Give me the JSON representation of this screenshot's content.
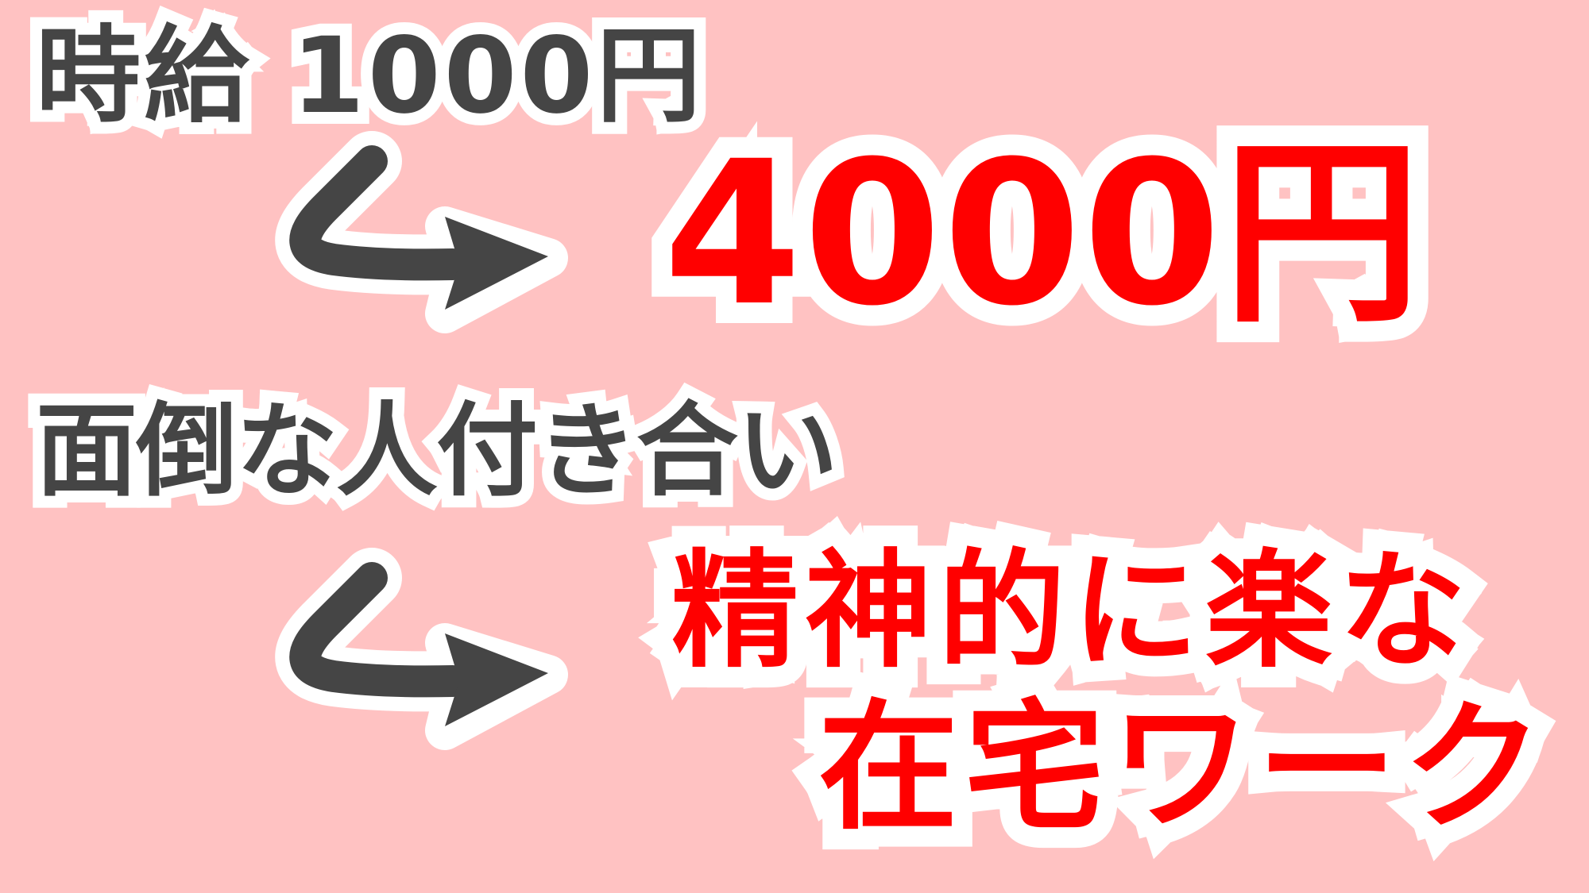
{
  "colors": {
    "background": "#ffc2c2",
    "dark_text": "#454545",
    "accent_red": "#ff0000",
    "outline": "#ffffff"
  },
  "top": {
    "before_text": "時給 1000円",
    "after_text": "4000円",
    "arrow_icon": "curved-arrow-right-icon"
  },
  "bottom": {
    "before_text": "面倒な人付き合い",
    "after_line1": "精神的に楽な",
    "after_line2": "在宅ワーク",
    "arrow_icon": "curved-arrow-right-icon"
  }
}
